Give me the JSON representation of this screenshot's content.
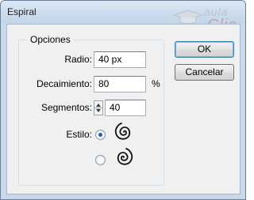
{
  "window": {
    "title": "Espiral",
    "watermark": {
      "line1": "aula",
      "line2": "Clic"
    }
  },
  "options_group": {
    "legend": "Opciones",
    "radius": {
      "label": "Radio:",
      "value": "40 px"
    },
    "decay": {
      "label": "Decaimiento:",
      "value": "80",
      "unit": "%"
    },
    "segments": {
      "label": "Segmentos:",
      "value": "40"
    },
    "style": {
      "label": "Estilo:",
      "options": [
        {
          "icon": "spiral-clockwise-icon",
          "selected": true
        },
        {
          "icon": "spiral-counterclockwise-icon",
          "selected": false
        }
      ]
    }
  },
  "buttons": {
    "ok": "OK",
    "cancel": "Cancelar"
  },
  "colors": {
    "titlebar": "#c3d5ea",
    "client": "#f0f0f0",
    "radio_selected": "#2a5fa8",
    "default_button_border": "#3c7fb1"
  }
}
